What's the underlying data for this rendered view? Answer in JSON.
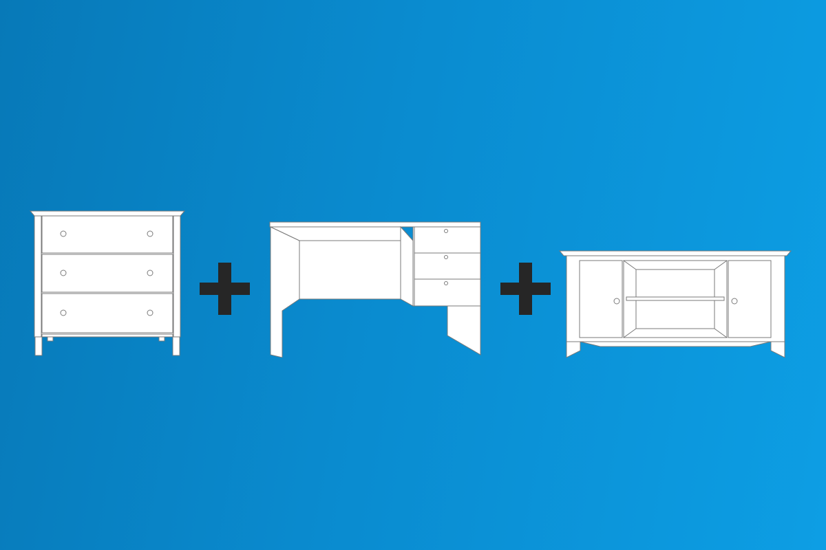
{
  "scene": {
    "background_colors": [
      "#0779b8",
      "#0d9ee4"
    ],
    "furniture_fill": "#ffffff",
    "furniture_stroke": "#7a7a7a",
    "plus_color": "#262626",
    "items": [
      {
        "icon": "dresser-icon",
        "drawers": 3
      },
      {
        "icon": "plus-icon"
      },
      {
        "icon": "desk-icon",
        "drawers": 3
      },
      {
        "icon": "plus-icon"
      },
      {
        "icon": "tv-stand-icon",
        "doors": 2,
        "shelves": 1
      }
    ]
  }
}
